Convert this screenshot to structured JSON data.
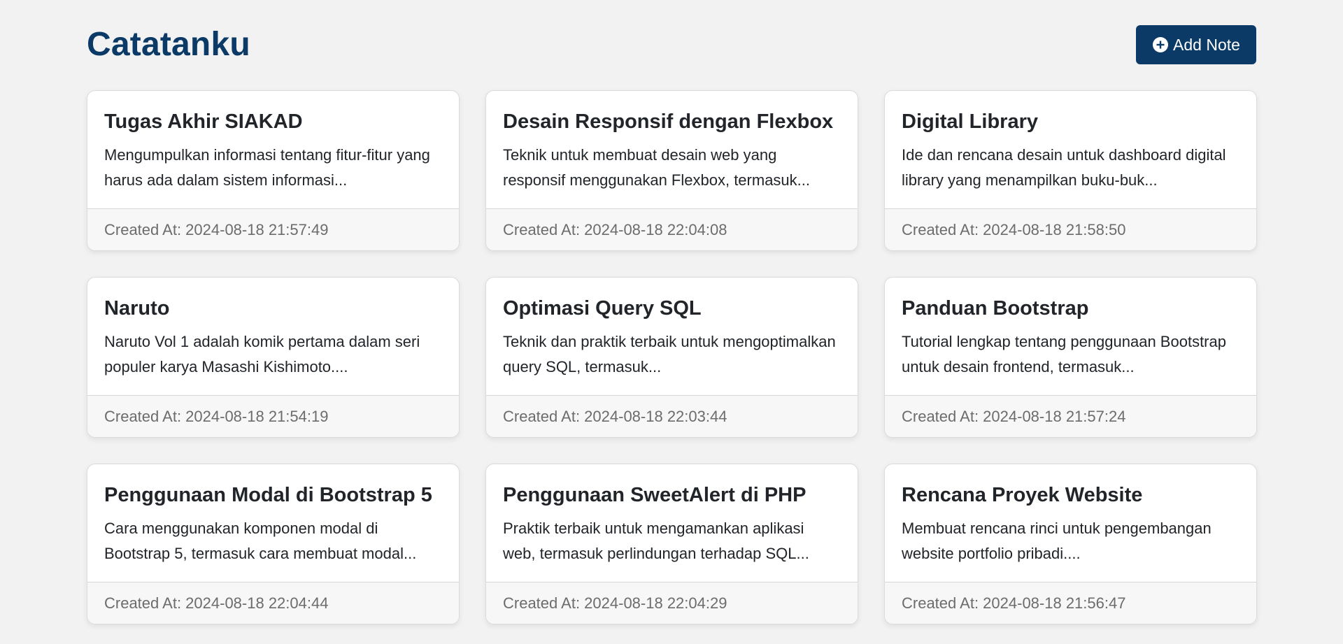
{
  "header": {
    "title": "Catatanku",
    "add_button_label": "Add Note",
    "add_button_icon": "plus-circle-icon"
  },
  "colors": {
    "brand": "#0b3a66",
    "background": "#f2f2f2",
    "card_footer": "#f7f7f7"
  },
  "notes": [
    {
      "title": "Tugas Akhir SIAKAD",
      "excerpt": "Mengumpulkan informasi tentang fitur-fitur yang harus ada dalam sistem informasi...",
      "created": "Created At: 2024-08-18 21:57:49"
    },
    {
      "title": "Desain Responsif dengan Flexbox",
      "excerpt": "Teknik untuk membuat desain web yang responsif menggunakan Flexbox, termasuk...",
      "created": "Created At: 2024-08-18 22:04:08"
    },
    {
      "title": "Digital Library",
      "excerpt": "Ide dan rencana desain untuk dashboard digital library yang menampilkan buku-buk...",
      "created": "Created At: 2024-08-18 21:58:50"
    },
    {
      "title": "Naruto",
      "excerpt": "Naruto Vol 1 adalah komik pertama dalam seri populer karya Masashi Kishimoto....",
      "created": "Created At: 2024-08-18 21:54:19"
    },
    {
      "title": "Optimasi Query SQL",
      "excerpt": "Teknik dan praktik terbaik untuk mengoptimalkan query SQL, termasuk...",
      "created": "Created At: 2024-08-18 22:03:44"
    },
    {
      "title": "Panduan Bootstrap",
      "excerpt": "Tutorial lengkap tentang penggunaan Bootstrap untuk desain frontend, termasuk...",
      "created": "Created At: 2024-08-18 21:57:24"
    },
    {
      "title": "Penggunaan Modal di Bootstrap 5",
      "excerpt": "Cara menggunakan komponen modal di Bootstrap 5, termasuk cara membuat modal...",
      "created": "Created At: 2024-08-18 22:04:44"
    },
    {
      "title": "Penggunaan SweetAlert di PHP",
      "excerpt": "Praktik terbaik untuk mengamankan aplikasi web, termasuk perlindungan terhadap SQL...",
      "created": "Created At: 2024-08-18 22:04:29"
    },
    {
      "title": "Rencana Proyek Website",
      "excerpt": "Membuat rencana rinci untuk pengembangan website portfolio pribadi....",
      "created": "Created At: 2024-08-18 21:56:47"
    }
  ]
}
